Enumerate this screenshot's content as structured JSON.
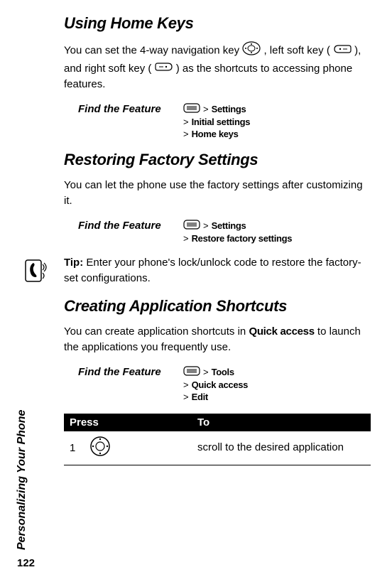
{
  "sidebar": {
    "vertical_text": "Personalizing Your Phone",
    "page_number": "122"
  },
  "section1": {
    "heading": "Using Home Keys",
    "p1a": "You can set the 4-way navigation key ",
    "p1b": " , left soft key ( ",
    "p1c": " ), and right soft key ( ",
    "p1d": " ) as the shortcuts to accessing phone features.",
    "feature_label": "Find the Feature",
    "path": [
      "Settings",
      "Initial settings",
      "Home keys"
    ]
  },
  "section2": {
    "heading": "Restoring Factory Settings",
    "p1": "You can let the phone use the factory settings after customizing it.",
    "feature_label": "Find the Feature",
    "path": [
      "Settings",
      "Restore factory settings"
    ],
    "tip_label": "Tip:",
    "tip_text": " Enter your phone's lock/unlock code to restore the factory-set configurations."
  },
  "section3": {
    "heading": "Creating Application Shortcuts",
    "p1a": "You can create application shortcuts in ",
    "p1_quick": "Quick access",
    "p1b": " to launch the applications you frequently use.",
    "feature_label": "Find the Feature",
    "path": [
      "Tools",
      "Quick access",
      "Edit"
    ],
    "table": {
      "headers": {
        "press": "Press",
        "to": "To"
      },
      "rows": [
        {
          "num": "1",
          "to": "scroll to the desired application"
        }
      ]
    }
  },
  "gt": ">"
}
